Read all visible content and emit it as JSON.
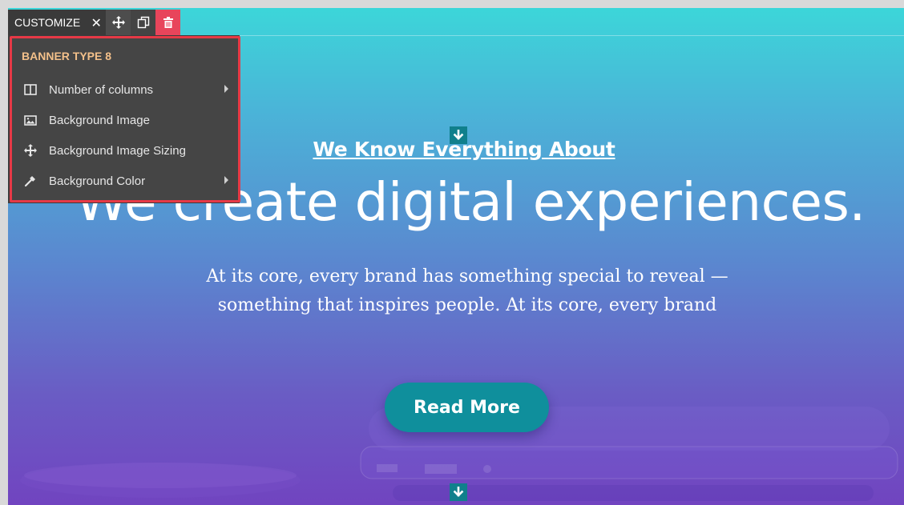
{
  "banner": {
    "kicker": "We Know Everything About",
    "headline": "We create digital experiences.",
    "body": "At its core, every brand has something special to reveal —something that inspires people. At its core, every brand",
    "button_label": "Read More"
  },
  "toolbar": {
    "label": "CUSTOMIZE",
    "close_icon": "close-icon",
    "move_icon": "move-icon",
    "copy_icon": "copy-icon",
    "delete_icon": "trash-icon"
  },
  "menu": {
    "title": "BANNER TYPE 8",
    "items": [
      {
        "label": "Number of columns",
        "icon": "columns-icon",
        "has_submenu": true
      },
      {
        "label": "Background Image",
        "icon": "image-icon",
        "has_submenu": false
      },
      {
        "label": "Background Image Sizing",
        "icon": "move-icon",
        "has_submenu": false
      },
      {
        "label": "Background Color",
        "icon": "eyedropper-icon",
        "has_submenu": true
      }
    ]
  },
  "colors": {
    "gradient_top": "#3cd6d9",
    "gradient_bottom": "#7144c0",
    "button_bg": "#0f8f9c",
    "menu_border": "#e63946",
    "menu_title": "#f3c08a",
    "delete_bg": "#e8455b"
  }
}
